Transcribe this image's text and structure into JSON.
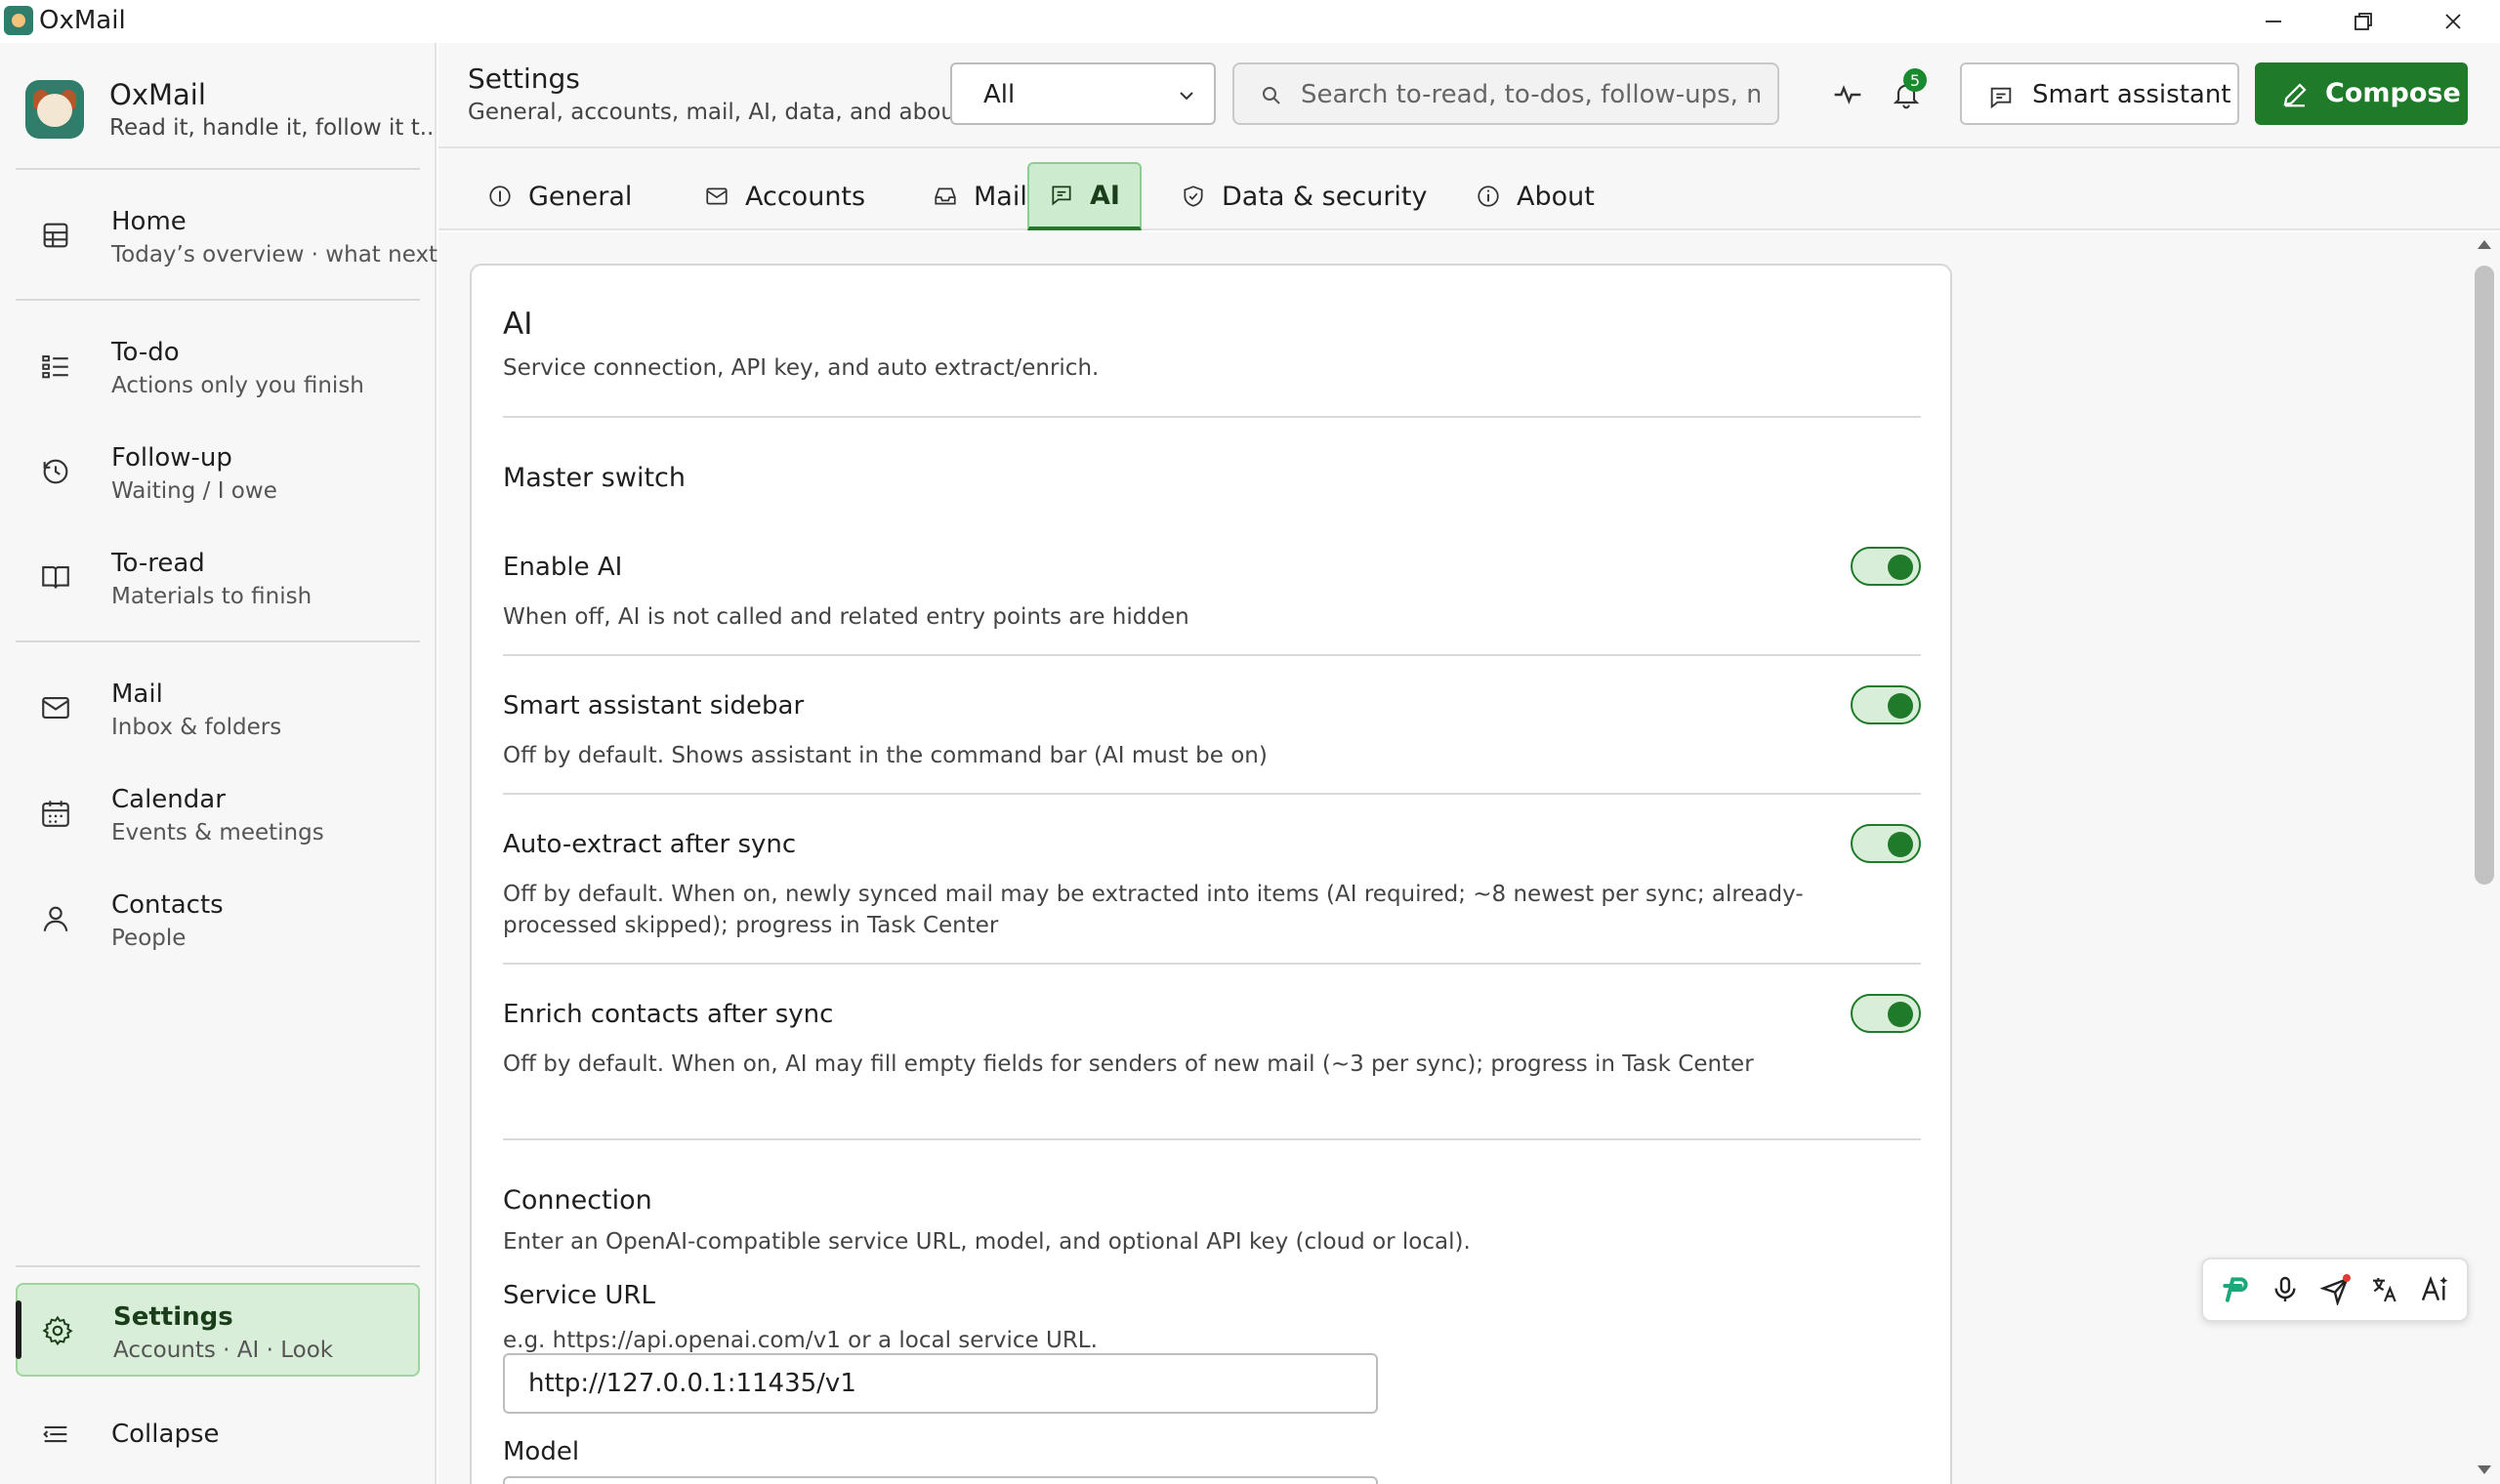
{
  "window": {
    "title": "OxMail",
    "controls": [
      "minimize",
      "maximize",
      "close"
    ]
  },
  "sidebar": {
    "brand_name": "OxMail",
    "brand_tagline": "Read it, handle it, follow it t...",
    "items": [
      {
        "title": "Home",
        "sub": "Today’s overview · what next",
        "icon": "grid-icon"
      },
      {
        "title": "To-do",
        "sub": "Actions only you finish",
        "icon": "checklist-icon"
      },
      {
        "title": "Follow-up",
        "sub": "Waiting / I owe",
        "icon": "clock-icon"
      },
      {
        "title": "To-read",
        "sub": "Materials to finish",
        "icon": "book-icon"
      },
      {
        "title": "Mail",
        "sub": "Inbox & folders",
        "icon": "mail-icon"
      },
      {
        "title": "Calendar",
        "sub": "Events & meetings",
        "icon": "calendar-icon"
      },
      {
        "title": "Contacts",
        "sub": "People",
        "icon": "person-icon"
      }
    ],
    "settings": {
      "title": "Settings",
      "sub": "Accounts · AI · Look",
      "icon": "gear-icon"
    },
    "collapse_label": "Collapse"
  },
  "header": {
    "title": "Settings",
    "subtitle": "General, accounts, mail, AI, data, and about.",
    "scope_value": "All",
    "search_placeholder": "Search to-read, to-dos, follow-ups, ma",
    "notification_count": "5",
    "assistant_label": "Smart assistant",
    "compose_label": "Compose"
  },
  "tabs": [
    {
      "label": "General",
      "icon": "info-icon"
    },
    {
      "label": "Accounts",
      "icon": "mail-icon"
    },
    {
      "label": "Mail",
      "icon": "inbox-icon"
    },
    {
      "label": "AI",
      "icon": "chat-icon",
      "active": true
    },
    {
      "label": "Data & security",
      "icon": "shield-icon"
    },
    {
      "label": "About",
      "icon": "info-icon"
    }
  ],
  "ai_panel": {
    "title": "AI",
    "subtitle": "Service connection, API key, and auto extract/enrich.",
    "master_switch_heading": "Master switch",
    "settings": [
      {
        "title": "Enable AI",
        "desc": "When off, AI is not called and related entry points are hidden",
        "on": true
      },
      {
        "title": "Smart assistant sidebar",
        "desc": "Off by default. Shows assistant in the command bar (AI must be on)",
        "on": true
      },
      {
        "title": "Auto-extract after sync",
        "desc": "Off by default. When on, newly synced mail may be extracted into items (AI required; ~8 newest per sync; already-processed skipped); progress in Task Center",
        "on": true
      },
      {
        "title": "Enrich contacts after sync",
        "desc": "Off by default. When on, AI may fill empty fields for senders of new mail (~3 per sync); progress in Task Center",
        "on": true
      }
    ],
    "connection": {
      "heading": "Connection",
      "desc": "Enter an OpenAI-compatible service URL, model, and optional API key (cloud or local).",
      "service_url_label": "Service URL",
      "service_url_hint": "e.g. https://api.openai.com/v1 or a local service URL.",
      "service_url_value": "http://127.0.0.1:11435/v1",
      "model_label": "Model"
    }
  },
  "colors": {
    "accent": "#1f7a2a",
    "active_bg": "#d8eed8",
    "badge": "#1a8a2e"
  },
  "float_toolbar": [
    "logo-icon",
    "microphone-icon",
    "send-icon",
    "translate-icon",
    "text-ai-icon"
  ]
}
